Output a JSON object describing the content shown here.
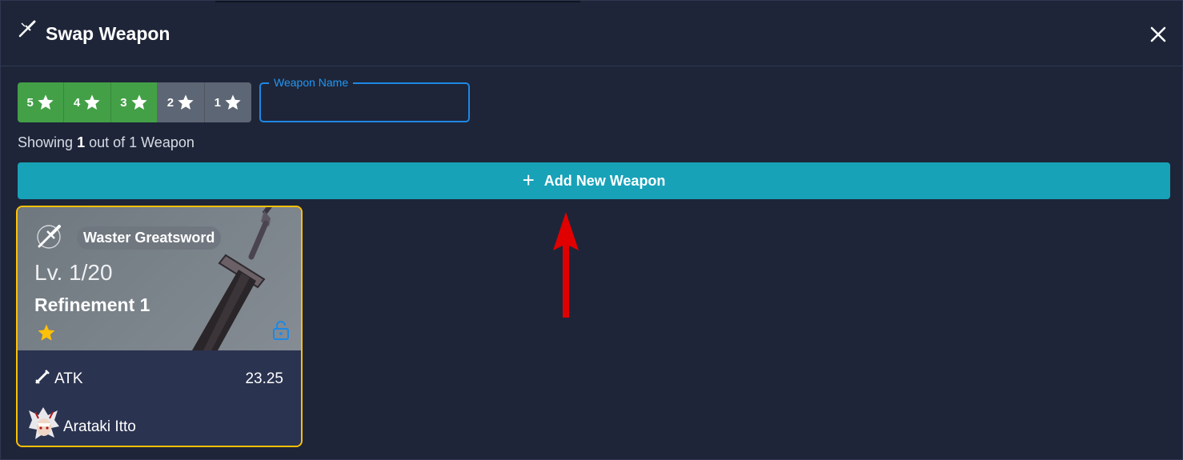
{
  "modal": {
    "title": "Swap Weapon",
    "title_icon": "claymore-icon",
    "close_icon": "close-icon"
  },
  "filters": {
    "rarities": [
      {
        "value": "5",
        "active": true
      },
      {
        "value": "4",
        "active": true
      },
      {
        "value": "3",
        "active": true
      },
      {
        "value": "2",
        "active": false
      },
      {
        "value": "1",
        "active": false
      }
    ],
    "weapon_name": {
      "label": "Weapon Name",
      "value": ""
    }
  },
  "showing": {
    "prefix": "Showing",
    "shown": "1",
    "middle": "out of 1 Weapon"
  },
  "add_button": {
    "icon": "+",
    "label": "Add New Weapon"
  },
  "weapon_card": {
    "name": "Waster Greatsword",
    "level": "Lv. 1/20",
    "refinement": "Refinement 1",
    "rarity": 1,
    "stat_name": "ATK",
    "stat_value": "23.25",
    "character": "Arataki Itto",
    "locked": false
  },
  "colors": {
    "background": "#1e2538",
    "active_rarity": "#43a047",
    "inactive_rarity": "#5d6674",
    "add_button": "#17a2b8",
    "input_border": "#1e88e5",
    "card_border": "#ffc107",
    "star": "#ffc107",
    "annotation_arrow": "#e00000"
  }
}
